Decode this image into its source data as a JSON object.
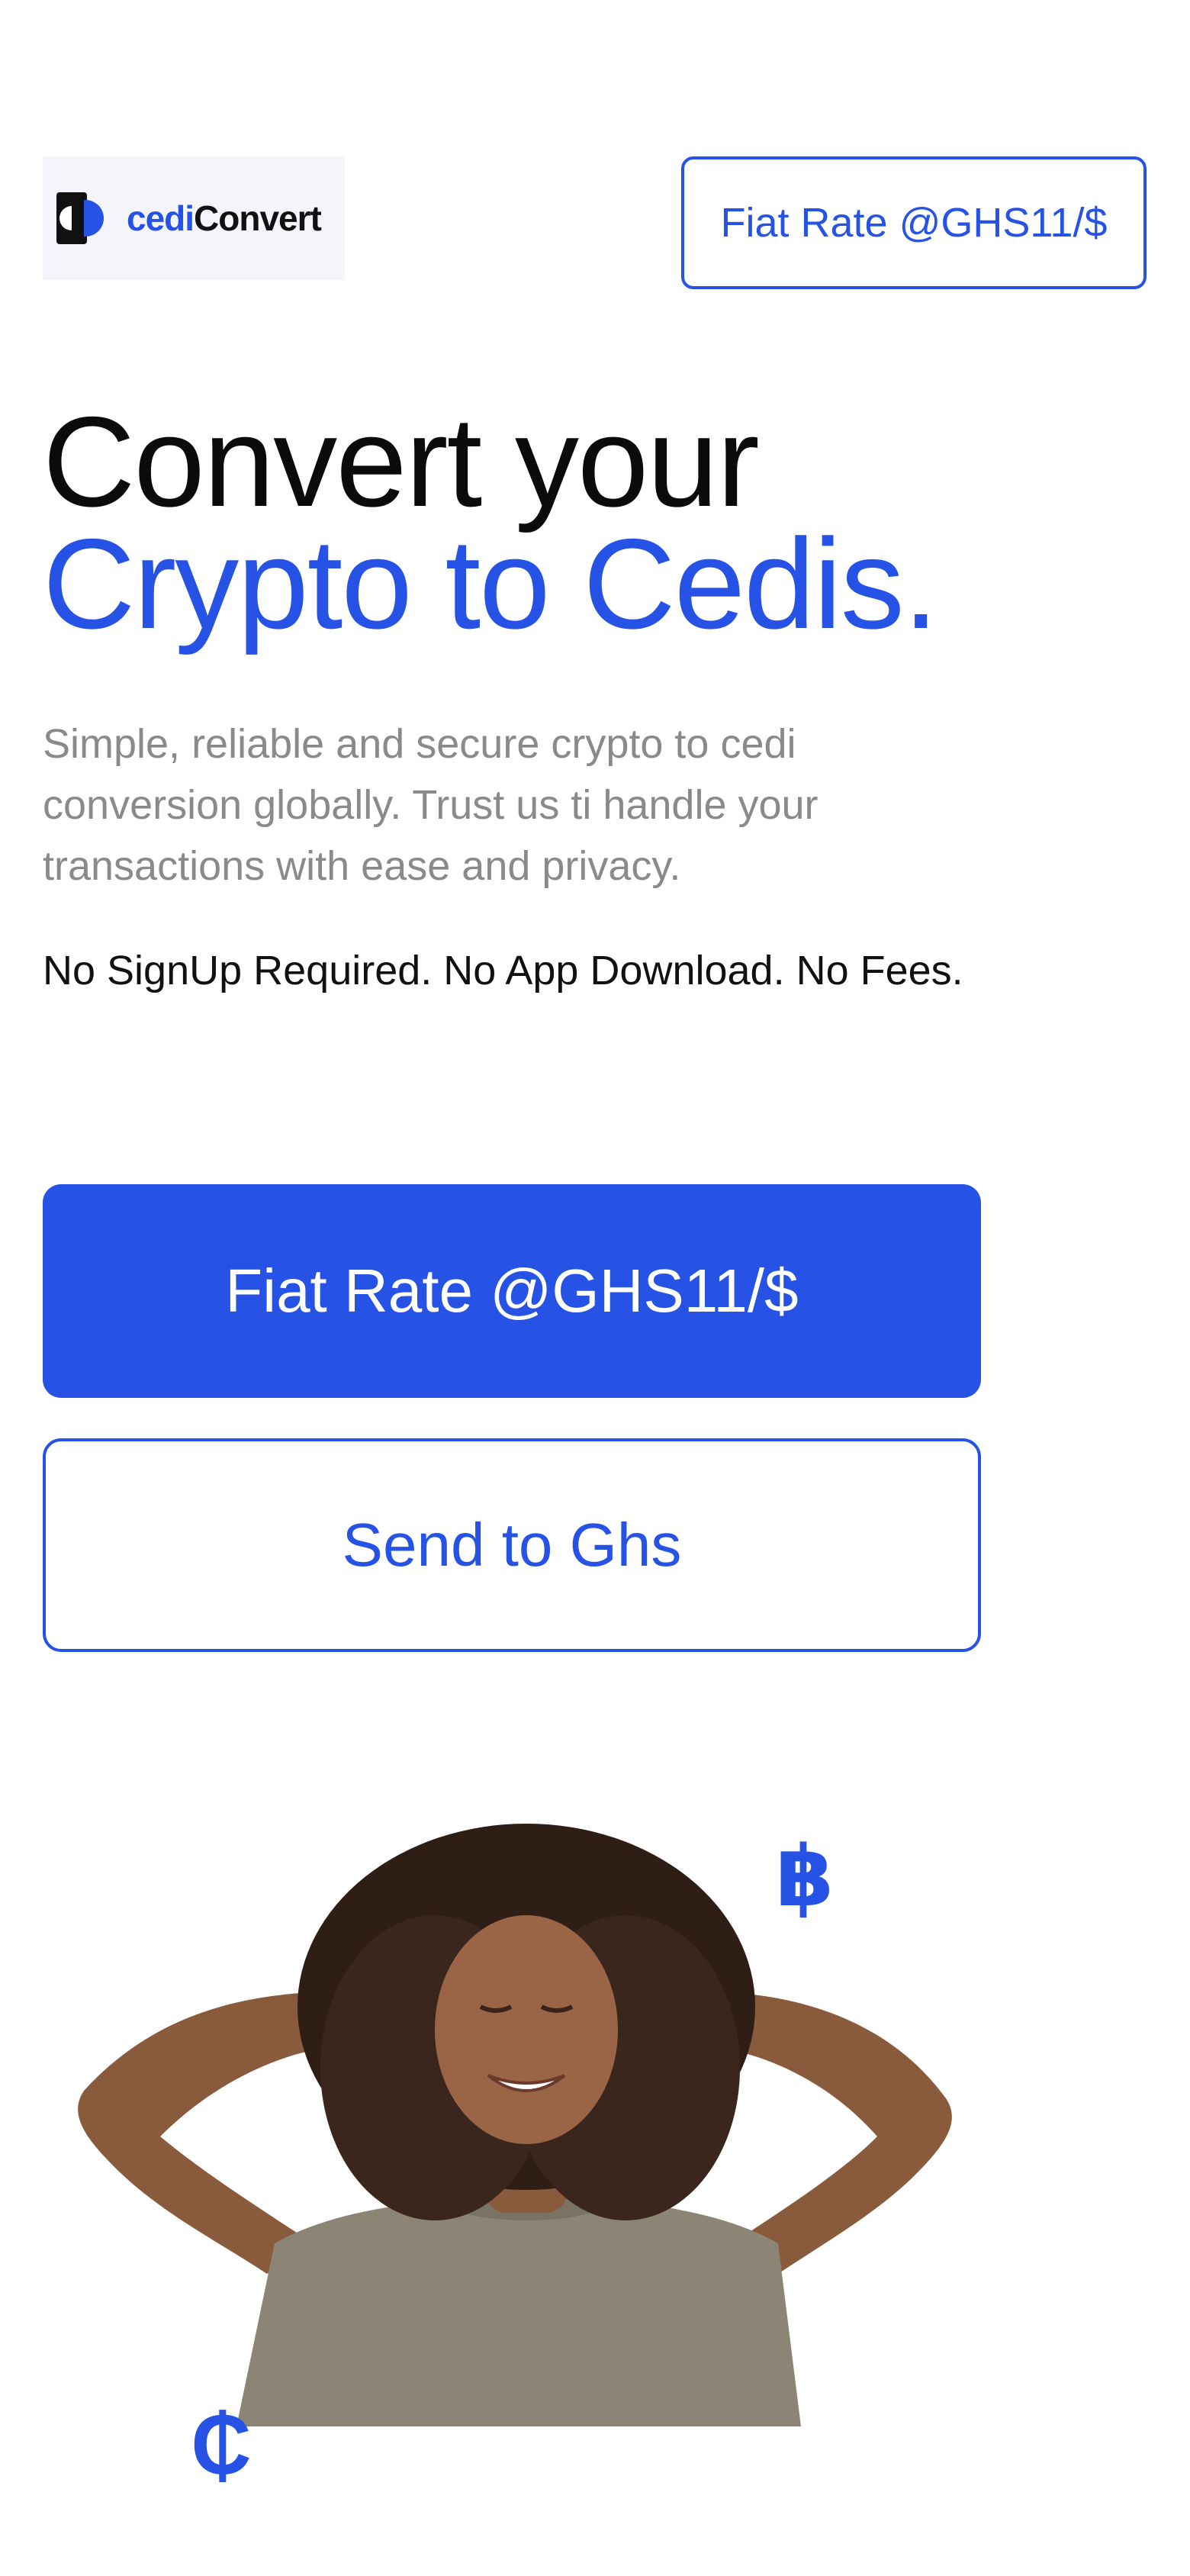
{
  "header": {
    "logo": {
      "text_part1": "cedi",
      "text_part2": "Convert",
      "icon": "cedi-convert-logo-mark"
    },
    "rate_button_label": "Fiat Rate @GHS11/$"
  },
  "hero": {
    "headline_line1": "Convert your",
    "headline_line2": "Crypto to Cedis.",
    "description": "Simple, reliable and secure crypto to cedi conversion globally. Trust us ti handle your transactions with ease and privacy.",
    "tagline": "No SignUp Required. No App Download. No Fees.",
    "primary_button_label": "Fiat Rate @GHS11/$",
    "secondary_button_label": "Send to Ghs"
  },
  "illustration": {
    "bitcoin_icon": "bitcoin-icon",
    "cedi_icon": "cedi-icon",
    "bitcoin_glyph": "฿",
    "cedi_glyph": "₵"
  },
  "colors": {
    "accent": "#2653e5",
    "text_dark": "#0b0b0b",
    "text_muted": "#8a8a8a",
    "logo_bg": "#f3f5fb"
  }
}
